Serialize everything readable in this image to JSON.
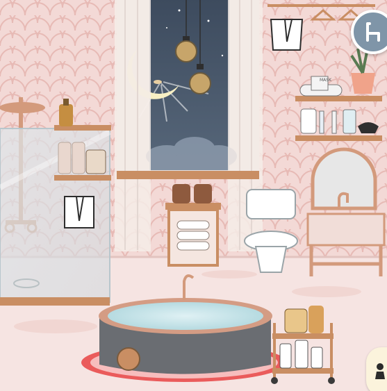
{
  "scene": {
    "room": "bathroom"
  },
  "labels": {
    "mask_box": "MASK"
  },
  "hud": {
    "chair_button_icon": "chair-icon",
    "people_button_icon": "person-icon"
  },
  "colors": {
    "wall": "#f3d9d6",
    "scallop": "#e8bdb8",
    "floor": "#f6e4e2",
    "wood": "#c98e63",
    "metal": "#d39a7c",
    "hud_blue": "#7f95a8"
  }
}
